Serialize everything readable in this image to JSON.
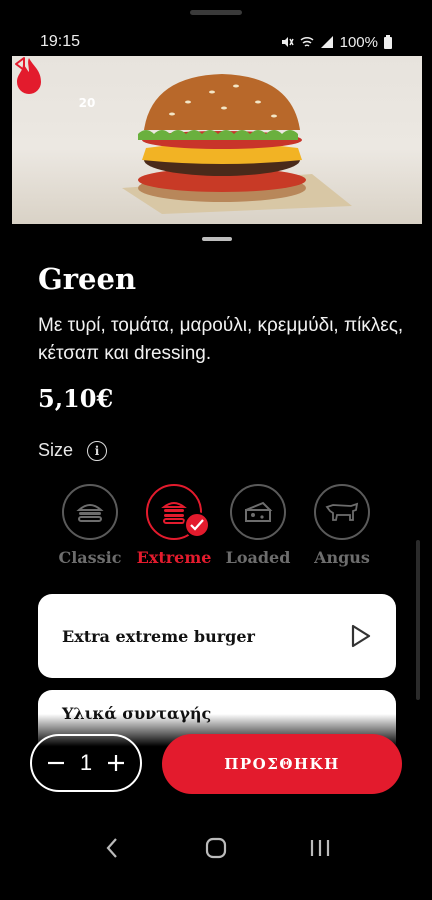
{
  "status_bar": {
    "time": "19:15",
    "battery": "100%"
  },
  "hero": {
    "fire_count": "20"
  },
  "product": {
    "name": "Green",
    "description": "Με τυρί, τομάτα, μαρούλι, κρεμμύδι, πίκλες, κέτσαπ και dressing.",
    "price": "5,10€"
  },
  "size_section": {
    "label": "Size",
    "options": [
      {
        "label": "Classic",
        "selected": false
      },
      {
        "label": "Extreme",
        "selected": true
      },
      {
        "label": "Loaded",
        "selected": false
      },
      {
        "label": "Angus",
        "selected": false
      }
    ]
  },
  "cards": {
    "extra": "Extra extreme burger",
    "ingredients": "Υλικά συνταγής"
  },
  "cart": {
    "quantity": "1",
    "add_label": "ΠΡΟΣΘΗΚΗ"
  },
  "colors": {
    "accent": "#e31b2d",
    "background": "#000000",
    "muted": "#6d6d6d"
  }
}
